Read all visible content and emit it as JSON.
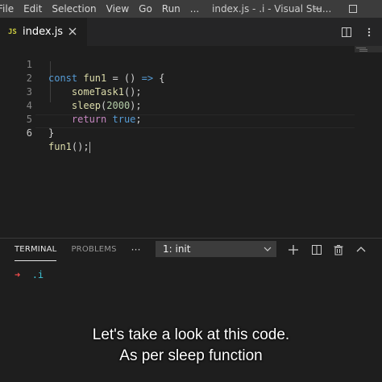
{
  "titlebar": {
    "menu": [
      "File",
      "Edit",
      "Selection",
      "View",
      "Go",
      "Run",
      "..."
    ],
    "title": "index.js - .i - Visual Stu..."
  },
  "tab": {
    "badge": "JS",
    "filename": "index.js"
  },
  "editor": {
    "line_numbers": [
      "1",
      "2",
      "3",
      "4",
      "5",
      "6"
    ],
    "code": {
      "l1_kw": "const",
      "l1_name": " fun1",
      "l1_rest": " = () ",
      "l1_arrow": "=>",
      "l1_brace": " {",
      "l2_fn": "someTask1",
      "l2_rest": "();",
      "l3_fn": "sleep",
      "l3_open": "(",
      "l3_num": "2000",
      "l3_close": ");",
      "l4_kw": "return",
      "l4_val": " true",
      "l4_semi": ";",
      "l5": "}",
      "l6_fn": "fun1",
      "l6_rest": "();"
    }
  },
  "panel": {
    "tabs": [
      "TERMINAL",
      "PROBLEMS"
    ],
    "more": "···",
    "terminal_select": "1: init",
    "prompt_arrow": "➜",
    "prompt_cwd": ".i"
  },
  "subtitles": {
    "line1": "Let's take a look at this code.",
    "line2": "As per sleep function"
  },
  "colors": {
    "background": "#1e1e1e",
    "titlebar": "#3c3c3c",
    "keyword": "#569cd6",
    "function": "#dcdcaa",
    "variable": "#9cdcfe",
    "number": "#b5cea8",
    "js_badge": "#cbcb41",
    "prompt_arrow": "#f14c4c",
    "prompt_cwd": "#3ec1d3"
  }
}
